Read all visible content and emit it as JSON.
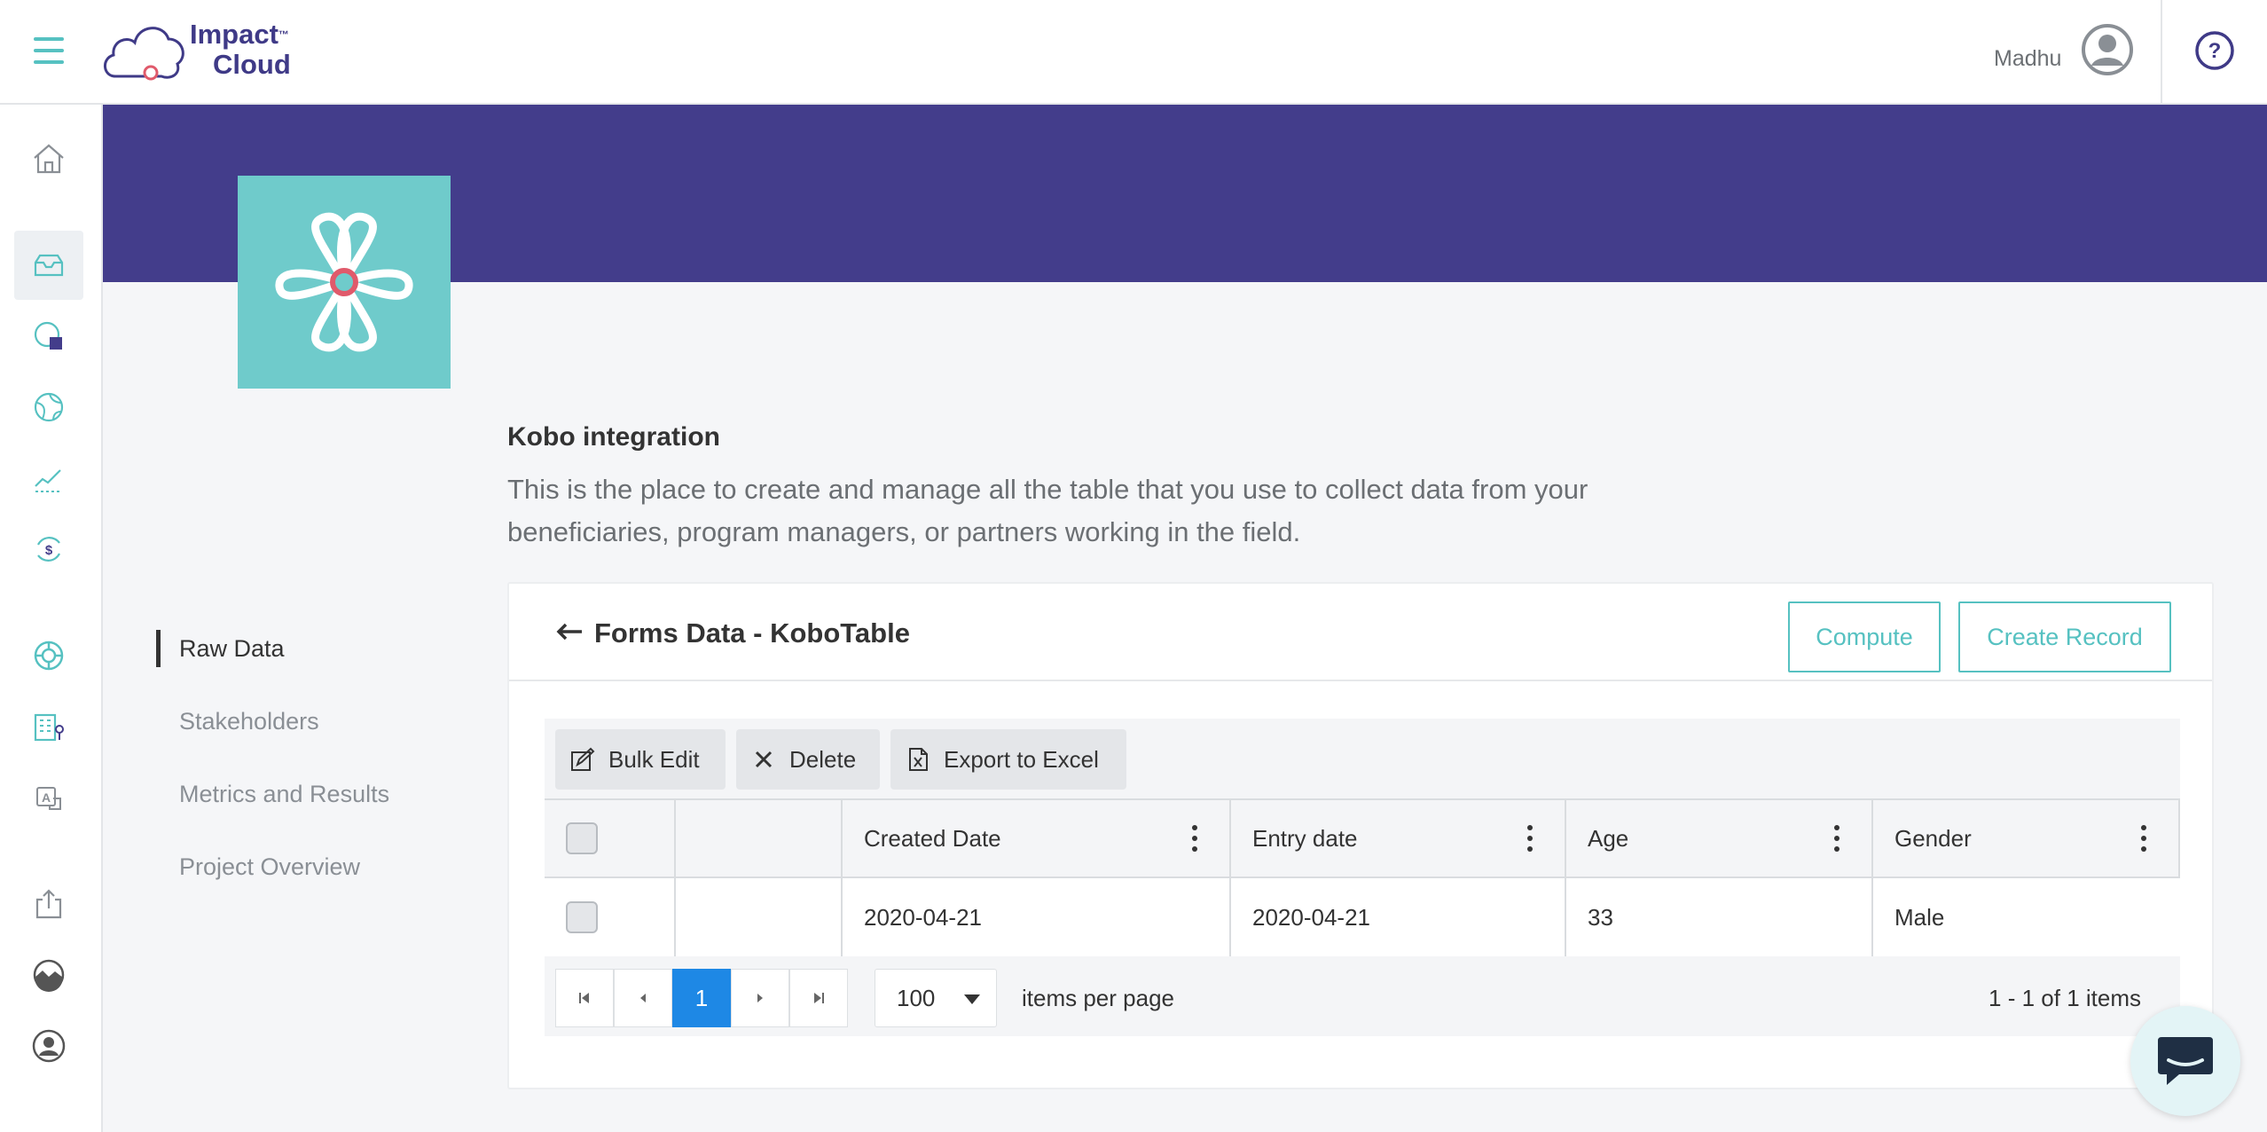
{
  "header": {
    "logo_line1": "Impact",
    "logo_tm": "™",
    "logo_line2": "Cloud",
    "user_name": "Madhu"
  },
  "rail": {
    "icons": [
      "home-icon",
      "inbox-icon",
      "database-icon",
      "globe-icon",
      "chart-icon",
      "finance-icon",
      "lifebuoy-icon",
      "building-icon",
      "translate-icon",
      "export-icon",
      "landscape-icon",
      "profile-icon"
    ],
    "active_index": 1
  },
  "intro": {
    "title": "Kobo integration",
    "description": "This is the place to create and manage all the table that you use to collect data from your beneficiaries, program managers, or partners working in the field."
  },
  "sidenav": {
    "items": [
      {
        "label": "Raw Data",
        "active": true
      },
      {
        "label": "Stakeholders",
        "active": false
      },
      {
        "label": "Metrics and Results",
        "active": false
      },
      {
        "label": "Project Overview",
        "active": false
      }
    ]
  },
  "card": {
    "title": "Forms Data - KoboTable",
    "compute_label": "Compute",
    "create_record_label": "Create Record"
  },
  "toolbar": {
    "bulk_edit_label": "Bulk Edit",
    "delete_label": "Delete",
    "export_label": "Export to Excel"
  },
  "table": {
    "columns": [
      "",
      "",
      "Created Date",
      "Entry date",
      "Age",
      "Gender"
    ],
    "rows": [
      {
        "created_date": "2020-04-21",
        "entry_date": "2020-04-21",
        "age": "33",
        "gender": "Male"
      }
    ]
  },
  "pager": {
    "current_page": "1",
    "page_size": "100",
    "items_per_page_label": "items per page",
    "info": "1 - 1 of 1 items"
  },
  "colors": {
    "brand_purple": "#433d8b",
    "accent_teal": "#56c1c1",
    "page_active_blue": "#1e88e5"
  }
}
